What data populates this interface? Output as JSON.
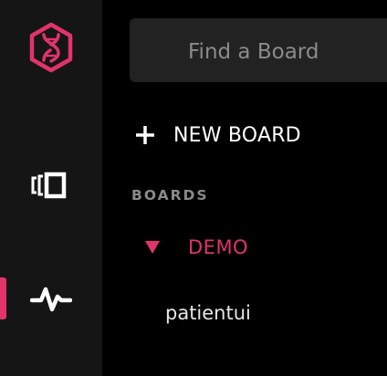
{
  "sidebar": {
    "items": [
      {
        "name": "logo",
        "icon": "dna-hexagon-icon"
      },
      {
        "name": "boards",
        "icon": "boards-icon"
      },
      {
        "name": "pulse",
        "icon": "pulse-icon",
        "active": true
      }
    ]
  },
  "search": {
    "placeholder": "Find a Board",
    "value": ""
  },
  "new_board": {
    "icon": "plus-icon",
    "label": "NEW BOARD"
  },
  "boards_section": {
    "header": "BOARDS",
    "groups": [
      {
        "label": "DEMO",
        "expanded": true,
        "icon": "caret-down-icon",
        "items": [
          {
            "label": "patientui"
          }
        ]
      }
    ]
  },
  "colors": {
    "accent": "#e2336b",
    "rail_background": "#151515",
    "background": "#000000",
    "search_background": "#222222",
    "muted_text": "#8a8a8a",
    "text": "#ffffff"
  }
}
